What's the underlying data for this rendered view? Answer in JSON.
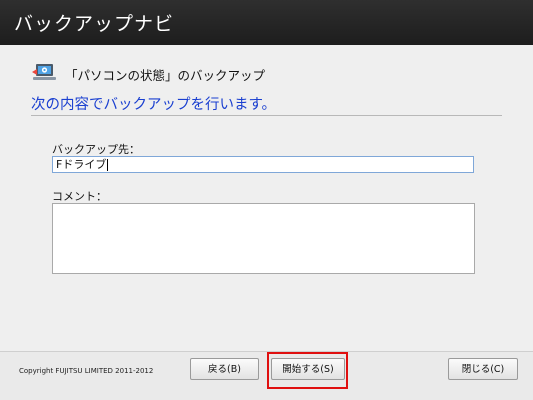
{
  "window": {
    "title": "バックアップナビ"
  },
  "main": {
    "heading": "「パソコンの状態」のバックアップ",
    "subheading": "次の内容でバックアップを行います。",
    "destination": {
      "label": "バックアップ先：",
      "value": "Fドライブ"
    },
    "comment": {
      "label": "コメント：",
      "value": ""
    }
  },
  "footer": {
    "copyright": "Copyright FUJITSU LIMITED 2011-2012",
    "back_label": "戻る(B)",
    "start_label": "開始する(S)",
    "close_label": "閉じる(C)"
  },
  "colors": {
    "title_bar": "#262626",
    "subheading": "#1a3fd0",
    "highlight": "#e01010"
  },
  "icons": {
    "heading_icon": "computer-backup-icon"
  }
}
